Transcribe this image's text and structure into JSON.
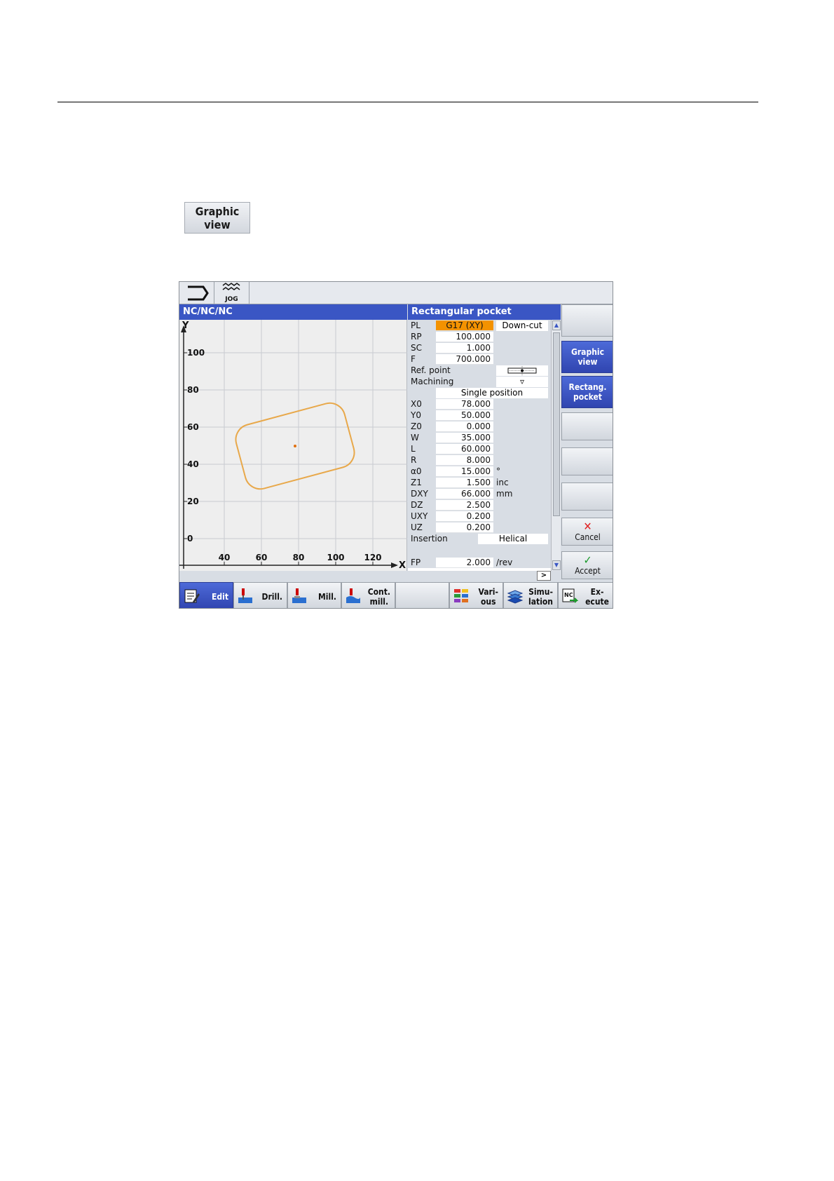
{
  "softkey_doc": {
    "line1": "Graphic",
    "line2": "view"
  },
  "topbar": {
    "jog_label": "JOG"
  },
  "graph": {
    "header": "NC/NC/NC",
    "y_axis_label": "Y",
    "x_axis_label": "X",
    "x_ticks": [
      "40",
      "60",
      "80",
      "100",
      "120"
    ],
    "y_ticks": [
      "100",
      "80",
      "60",
      "40",
      "20",
      "0"
    ],
    "pocket_color": "#e8a84a"
  },
  "form": {
    "title": "Rectangular pocket",
    "pl_label": "PL",
    "pl_value": "G17 (XY)",
    "pl_extra": "Down-cut",
    "rp_label": "RP",
    "rp_value": "100.000",
    "sc_label": "SC",
    "sc_value": "1.000",
    "f_label": "F",
    "f_value": "700.000",
    "ref_label": "Ref. point",
    "machining_label": "Machining",
    "machining_value": "▿",
    "position_value": "Single position",
    "x0_label": "X0",
    "x0_value": "78.000",
    "y0_label": "Y0",
    "y0_value": "50.000",
    "z0_label": "Z0",
    "z0_value": "0.000",
    "w_label": "W",
    "w_value": "35.000",
    "l_label": "L",
    "l_value": "60.000",
    "r_label": "R",
    "r_value": "8.000",
    "a0_label": "α0",
    "a0_value": "15.000",
    "a0_unit": "°",
    "z1_label": "Z1",
    "z1_value": "1.500",
    "z1_unit": "inc",
    "dxy_label": "DXY",
    "dxy_value": "66.000",
    "dxy_unit": "mm",
    "dz_label": "DZ",
    "dz_value": "2.500",
    "uxy_label": "UXY",
    "uxy_value": "0.200",
    "uz_label": "UZ",
    "uz_value": "0.200",
    "insertion_label": "Insertion",
    "insertion_value": "Helical",
    "fp_label": "FP",
    "fp_value": "2.000",
    "fp_unit": "/rev",
    "more_label": ">"
  },
  "vertical_softkeys": {
    "graphic_view": [
      "Graphic",
      "view"
    ],
    "rect_pocket": [
      "Rectang.",
      "pocket"
    ],
    "cancel": "Cancel",
    "accept": "Accept"
  },
  "horizontal_softkeys": {
    "edit": "Edit",
    "drill": "Drill.",
    "mill": "Mill.",
    "cont_mill": [
      "Cont.",
      "mill."
    ],
    "various": [
      "Vari-",
      "ous"
    ],
    "simulation": [
      "Simu-",
      "lation"
    ],
    "execute": [
      "Ex-",
      "ecute"
    ],
    "nc_icon_text": "NC"
  },
  "colors": {
    "header_blue": "#3a56c4",
    "highlight_orange": "#f39200",
    "cancel_red": "#e02020",
    "accept_green": "#1a9a2a"
  }
}
